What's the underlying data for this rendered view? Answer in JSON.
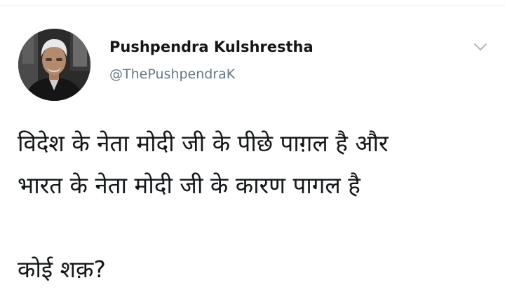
{
  "author": {
    "display_name": "Pushpendra Kulshrestha",
    "handle": "@ThePushpendraK"
  },
  "icons": {
    "more": "chevron-down-icon",
    "avatar": "profile-photo"
  },
  "tweet": {
    "line1": "विदेश के नेता मोदी जी के पीछे पाग़ल है और",
    "line2": "भारत के नेता मोदी जी के कारण पागल है",
    "line3": "कोई शक़?"
  },
  "colors": {
    "text": "#14171a",
    "secondary": "#657786",
    "chevron": "#aab8c2"
  }
}
